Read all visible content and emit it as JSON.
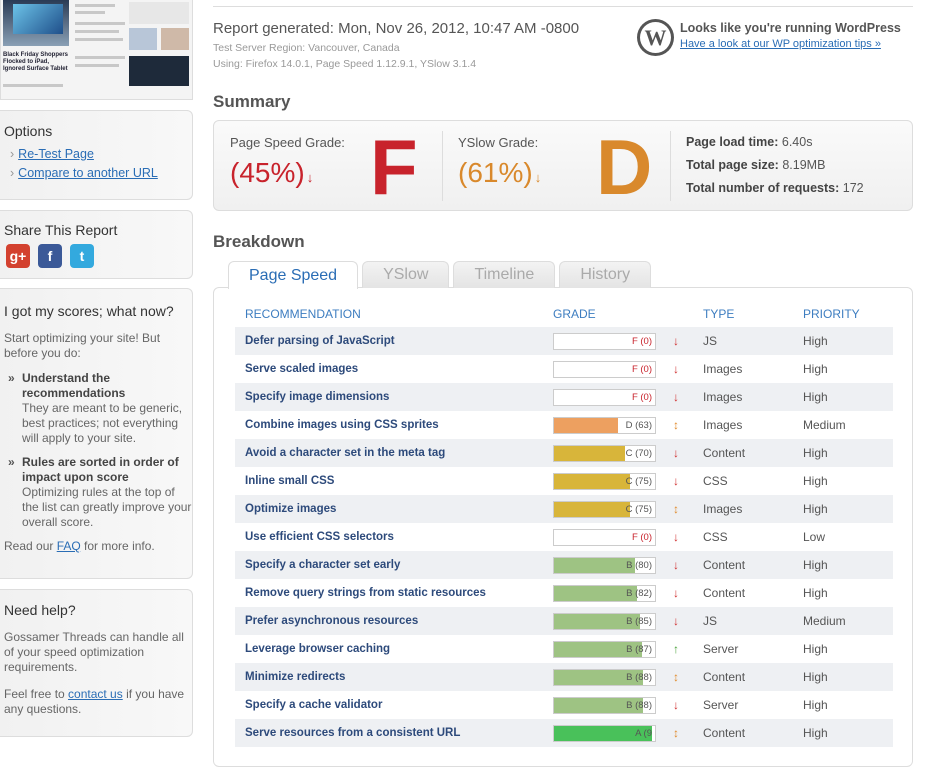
{
  "sidebar": {
    "thumb_headline": "Black Friday Shoppers Flocked to iPad, Ignored Surface Tablet",
    "options_title": "Options",
    "options": [
      "Re-Test Page",
      "Compare to another URL"
    ],
    "share_title": "Share This Report",
    "share_icons": [
      {
        "name": "google-plus-icon",
        "glyph": "g+",
        "color": "#d3412f"
      },
      {
        "name": "facebook-icon",
        "glyph": "f",
        "color": "#3b5998"
      },
      {
        "name": "twitter-icon",
        "glyph": "t",
        "color": "#33a9de"
      }
    ],
    "scores_title": "I got my scores; what now?",
    "scores_intro": "Start optimizing your site! But before you do:",
    "bullets": [
      {
        "title": "Understand the recommendations",
        "text": "They are meant to be generic, best practices; not everything will apply to your site."
      },
      {
        "title": "Rules are sorted in order of impact upon score",
        "text": "Optimizing rules at the top of the list can greatly improve your overall score."
      }
    ],
    "faq_prefix": "Read our ",
    "faq_link": "FAQ",
    "faq_suffix": " for more info.",
    "help_title": "Need help?",
    "help_text1": "Gossamer Threads can handle all of your speed optimization requirements.",
    "help_prefix": "Feel free to ",
    "help_link": "contact us",
    "help_suffix": " if you have any questions."
  },
  "report": {
    "title": "Report generated: Mon, Nov 26, 2012, 10:47 AM -0800",
    "region": "Test Server Region: Vancouver, Canada",
    "using": "Using: Firefox 14.0.1, Page Speed 1.12.9.1, YSlow 3.1.4"
  },
  "wp": {
    "logo": "W",
    "title": "Looks like you're running WordPress",
    "link": "Have a look at our WP optimization tips »"
  },
  "summary": {
    "heading": "Summary",
    "pagespeed_label": "Page Speed Grade:",
    "pagespeed_pct": "(45%)",
    "pagespeed_letter": "F",
    "yslow_label": "YSlow Grade:",
    "yslow_pct": "(61%)",
    "yslow_letter": "D",
    "down_arrow": "↓",
    "load_time_label": "Page load time:",
    "load_time": "6.40s",
    "size_label": "Total page size:",
    "size": "8.19MB",
    "requests_label": "Total number of requests:",
    "requests": "172",
    "colors": {
      "pagespeed": "#c8232c",
      "yslow": "#d9892c"
    }
  },
  "breakdown": {
    "heading": "Breakdown",
    "tabs": [
      "Page Speed",
      "YSlow",
      "Timeline",
      "History"
    ],
    "columns": [
      "RECOMMENDATION",
      "GRADE",
      "TYPE",
      "PRIORITY"
    ],
    "rows": [
      {
        "name": "Defer parsing of JavaScript",
        "grade": "F (0)",
        "score": 0,
        "trend": "↓",
        "trend_color": "#d03030",
        "type": "JS",
        "priority": "High"
      },
      {
        "name": "Serve scaled images",
        "grade": "F (0)",
        "score": 0,
        "trend": "↓",
        "trend_color": "#d03030",
        "type": "Images",
        "priority": "High"
      },
      {
        "name": "Specify image dimensions",
        "grade": "F (0)",
        "score": 0,
        "trend": "↓",
        "trend_color": "#d03030",
        "type": "Images",
        "priority": "High"
      },
      {
        "name": "Combine images using CSS sprites",
        "grade": "D (63)",
        "score": 63,
        "trend": "↕",
        "trend_color": "#e08a2a",
        "type": "Images",
        "priority": "Medium"
      },
      {
        "name": "Avoid a character set in the meta tag",
        "grade": "C (70)",
        "score": 70,
        "trend": "↓",
        "trend_color": "#d03030",
        "type": "Content",
        "priority": "High"
      },
      {
        "name": "Inline small CSS",
        "grade": "C (75)",
        "score": 75,
        "trend": "↓",
        "trend_color": "#d03030",
        "type": "CSS",
        "priority": "High"
      },
      {
        "name": "Optimize images",
        "grade": "C (75)",
        "score": 75,
        "trend": "↕",
        "trend_color": "#e08a2a",
        "type": "Images",
        "priority": "High"
      },
      {
        "name": "Use efficient CSS selectors",
        "grade": "F (0)",
        "score": 0,
        "trend": "↓",
        "trend_color": "#d03030",
        "type": "CSS",
        "priority": "Low"
      },
      {
        "name": "Specify a character set early",
        "grade": "B (80)",
        "score": 80,
        "trend": "↓",
        "trend_color": "#d03030",
        "type": "Content",
        "priority": "High"
      },
      {
        "name": "Remove query strings from static resources",
        "grade": "B (82)",
        "score": 82,
        "trend": "↓",
        "trend_color": "#d03030",
        "type": "Content",
        "priority": "High"
      },
      {
        "name": "Prefer asynchronous resources",
        "grade": "B (85)",
        "score": 85,
        "trend": "↓",
        "trend_color": "#d03030",
        "type": "JS",
        "priority": "Medium"
      },
      {
        "name": "Leverage browser caching",
        "grade": "B (87)",
        "score": 87,
        "trend": "↑",
        "trend_color": "#4aa33a",
        "type": "Server",
        "priority": "High"
      },
      {
        "name": "Minimize redirects",
        "grade": "B (88)",
        "score": 88,
        "trend": "↕",
        "trend_color": "#e08a2a",
        "type": "Content",
        "priority": "High"
      },
      {
        "name": "Specify a cache validator",
        "grade": "B (88)",
        "score": 88,
        "trend": "↓",
        "trend_color": "#d03030",
        "type": "Server",
        "priority": "High"
      },
      {
        "name": "Serve resources from a consistent URL",
        "grade": "A (9",
        "score": 97,
        "trend": "↕",
        "trend_color": "#e08a2a",
        "type": "Content",
        "priority": "High"
      }
    ],
    "fill_colors": {
      "D": "#eda060",
      "C": "#d8b53a",
      "B": "#9ec383",
      "A": "#49c15a"
    }
  }
}
